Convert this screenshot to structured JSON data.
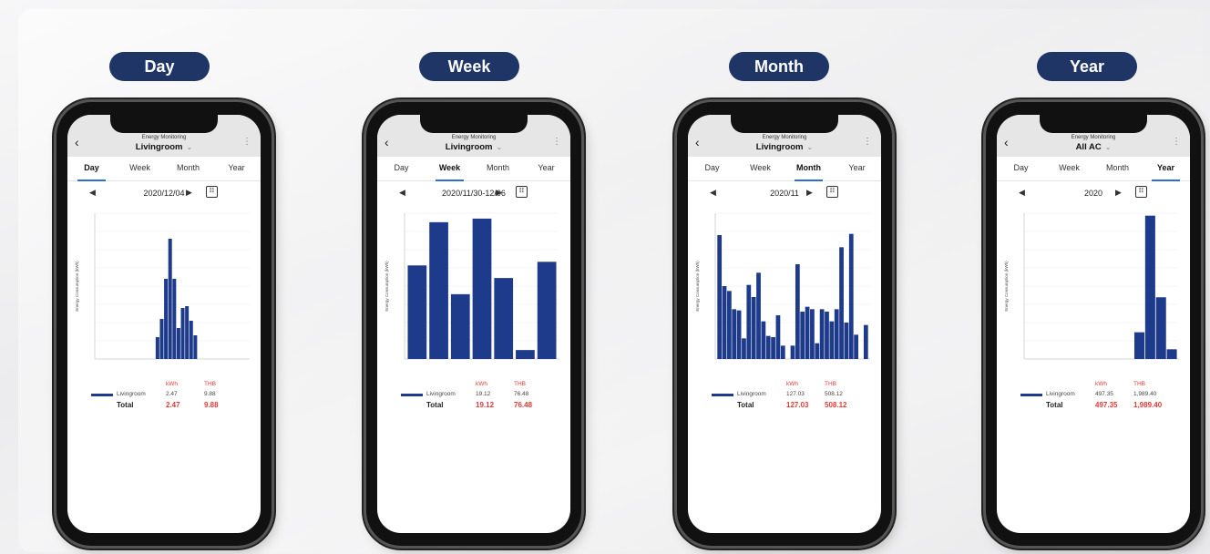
{
  "tab_labels": [
    "Day",
    "Week",
    "Month",
    "Year"
  ],
  "panels": [
    {
      "heading": "Day",
      "app_title": "Energy Monitoring",
      "room": "Livingroom",
      "active_tab": 0,
      "date": "2020/12/04",
      "kwh_label": "kWh",
      "thb_label": "THB",
      "legend_name": "Livingroom",
      "row_kwh": "2.47",
      "row_thb": "9.88",
      "total_label": "Total",
      "total_kwh": "2.47",
      "total_thb": "9.88"
    },
    {
      "heading": "Week",
      "app_title": "Energy Monitoring",
      "room": "Livingroom",
      "active_tab": 1,
      "date": "2020/11/30-12/06",
      "kwh_label": "kWh",
      "thb_label": "THB",
      "legend_name": "Livingroom",
      "row_kwh": "19.12",
      "row_thb": "76.48",
      "total_label": "Total",
      "total_kwh": "19.12",
      "total_thb": "76.48"
    },
    {
      "heading": "Month",
      "app_title": "Energy Monitoring",
      "room": "Livingroom",
      "active_tab": 2,
      "date": "2020/11",
      "kwh_label": "kWh",
      "thb_label": "THB",
      "legend_name": "Livingroom",
      "row_kwh": "127.03",
      "row_thb": "508.12",
      "total_label": "Total",
      "total_kwh": "127.03",
      "total_thb": "508.12"
    },
    {
      "heading": "Year",
      "app_title": "Energy Monitoring",
      "room": "All AC",
      "active_tab": 3,
      "date": "2020",
      "kwh_label": "kWh",
      "thb_label": "THB",
      "legend_name": "Livingroom",
      "row_kwh": "497.35",
      "row_thb": "1,989.40",
      "total_label": "Total",
      "total_kwh": "497.35",
      "total_thb": "1,989.40"
    }
  ],
  "chart_data": [
    {
      "type": "bar",
      "ylabel": "Energy Consumption (kWh)",
      "ylim": [
        0,
        0.8
      ],
      "color": "#1e3a8a",
      "values": [
        0,
        0,
        0,
        0,
        0,
        0,
        0,
        0,
        0,
        0,
        0,
        0,
        0,
        0,
        0.12,
        0.22,
        0.44,
        0.66,
        0.44,
        0.17,
        0.28,
        0.29,
        0.21,
        0.13,
        0,
        0,
        0,
        0,
        0,
        0,
        0,
        0,
        0,
        0,
        0,
        0
      ]
    },
    {
      "type": "bar",
      "ylabel": "Energy Consumption (kWh)",
      "ylim": [
        0,
        8.1
      ],
      "color": "#1e3a8a",
      "values": [
        5.2,
        7.6,
        3.6,
        7.8,
        4.5,
        0.5,
        5.4
      ]
    },
    {
      "type": "bar",
      "ylabel": "Energy Consumption (kWh)",
      "ylim": [
        0,
        12
      ],
      "color": "#1e3a8a",
      "values": [
        10.2,
        6.0,
        5.6,
        4.1,
        4.0,
        1.7,
        6.1,
        5.1,
        7.1,
        3.1,
        1.9,
        1.8,
        3.6,
        1.1,
        0,
        1.1,
        7.8,
        3.9,
        4.3,
        4.1,
        1.3,
        4.1,
        3.9,
        3.1,
        4.1,
        9.2,
        3.0,
        10.3,
        2.0,
        0,
        2.8
      ]
    },
    {
      "type": "bar",
      "ylabel": "Energy Consumption (kWh)",
      "ylim": [
        0,
        300
      ],
      "color": "#1e3a8a",
      "values": [
        0,
        0,
        0,
        0,
        0,
        0,
        0,
        0,
        0,
        0,
        55,
        295,
        127,
        20
      ]
    }
  ]
}
